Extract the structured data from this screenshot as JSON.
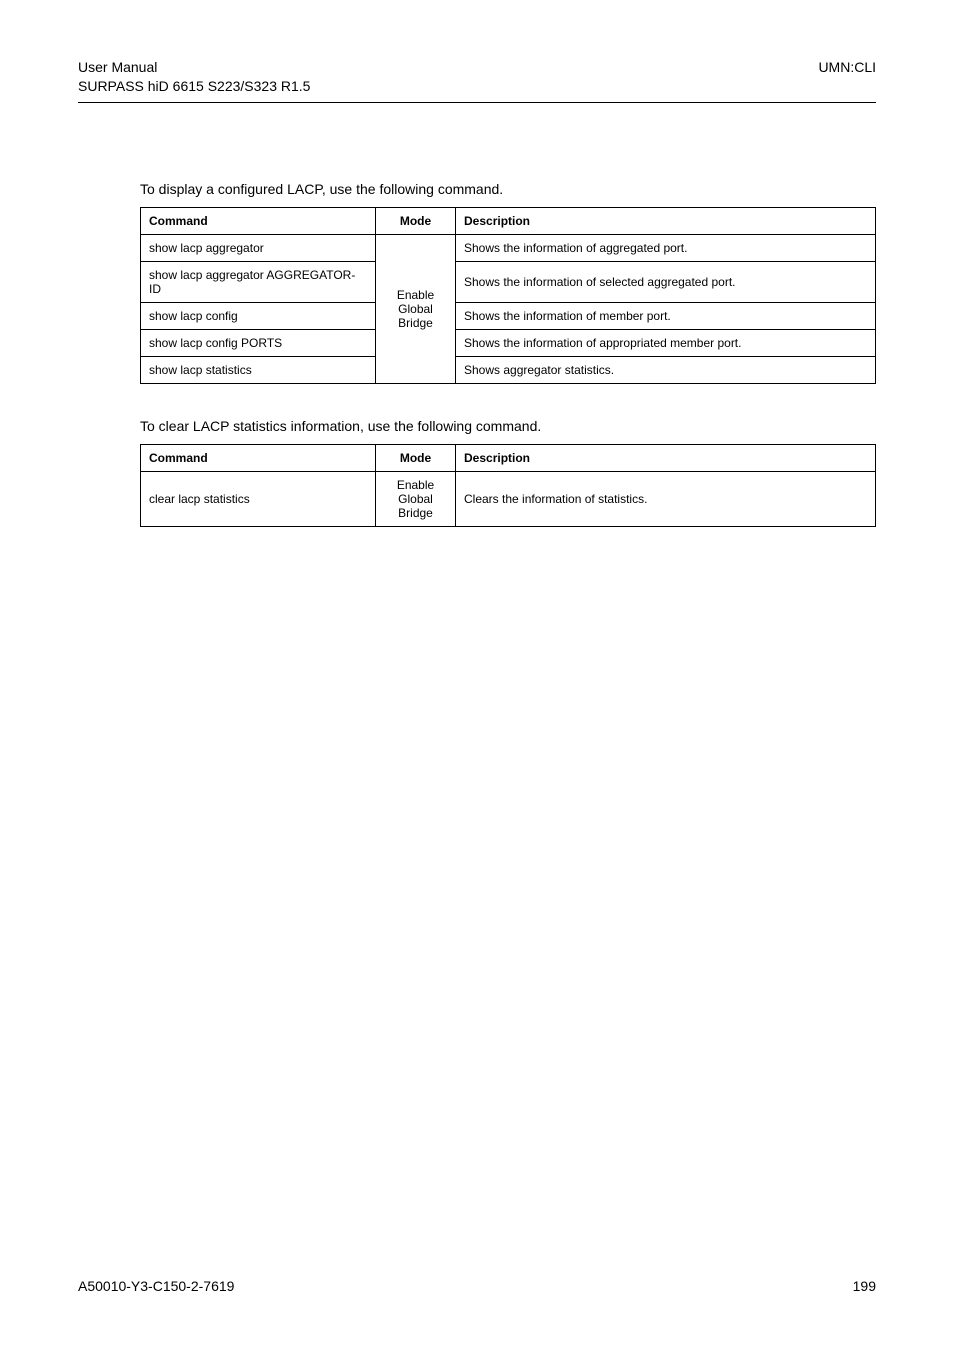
{
  "header": {
    "left_line1": "User  Manual",
    "left_line2": "SURPASS hiD 6615 S223/S323 R1.5",
    "right": "UMN:CLI"
  },
  "intro1": "To display a configured LACP, use the following command.",
  "table1": {
    "headers": {
      "cmd": "Command",
      "mode": "Mode",
      "desc": "Description"
    },
    "mode_lines": [
      "Enable",
      "Global",
      "Bridge"
    ],
    "rows": [
      {
        "cmd": "show lacp aggregator",
        "desc": "Shows the information of aggregated port."
      },
      {
        "cmd": "show lacp aggregator AGGREGATOR-ID",
        "desc": "Shows the information of selected aggregated port."
      },
      {
        "cmd": "show lacp config",
        "desc": "Shows the information of member port."
      },
      {
        "cmd": "show lacp config PORTS",
        "desc": "Shows the information of appropriated member port."
      },
      {
        "cmd": "show lacp statistics",
        "desc": "Shows aggregator statistics."
      }
    ]
  },
  "intro2": "To clear LACP statistics information, use the following command.",
  "table2": {
    "headers": {
      "cmd": "Command",
      "mode": "Mode",
      "desc": "Description"
    },
    "mode_lines": [
      "Enable",
      "Global",
      "Bridge"
    ],
    "rows": [
      {
        "cmd": "clear lacp statistics",
        "desc": "Clears the information of statistics."
      }
    ]
  },
  "footer": {
    "left": "A50010-Y3-C150-2-7619",
    "right": "199"
  }
}
